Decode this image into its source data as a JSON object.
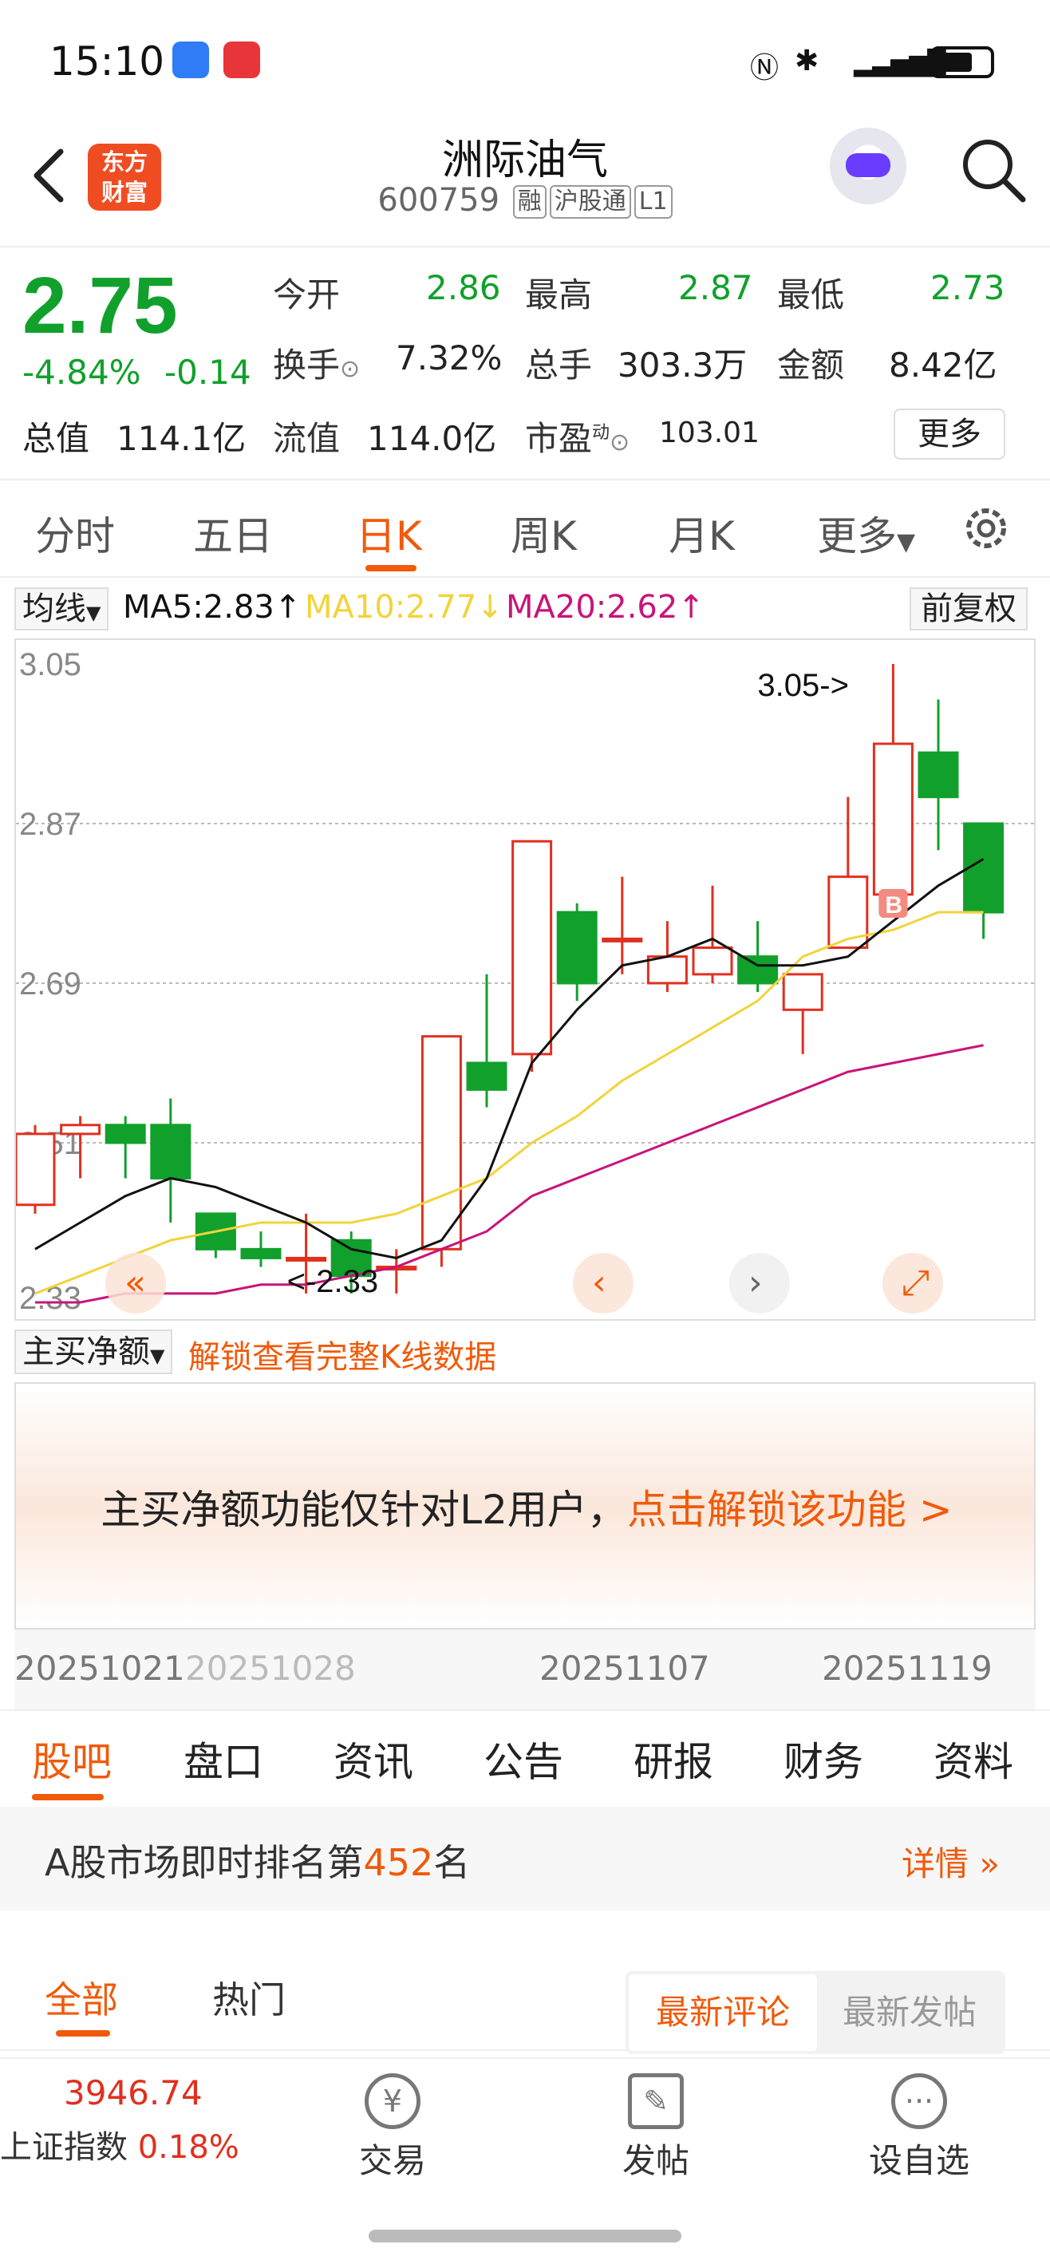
{
  "status_bar": {
    "time": "15:10"
  },
  "header": {
    "logo_line1": "东方",
    "logo_line2": "财富",
    "stock_name": "洲际油气",
    "stock_code": "600759",
    "tags": [
      "融",
      "沪股通",
      "L1"
    ]
  },
  "quote": {
    "price": "2.75",
    "change_pct": "-4.84%",
    "change_amt": "-0.14",
    "open_label": "今开",
    "open": "2.86",
    "high_label": "最高",
    "high": "2.87",
    "low_label": "最低",
    "low": "2.73",
    "turnover_label": "换手",
    "turnover": "7.32%",
    "volume_label": "总手",
    "volume": "303.3万",
    "amount_label": "金额",
    "amount": "8.42亿",
    "mktcap_label": "总值",
    "mktcap": "114.1亿",
    "float_label": "流值",
    "float": "114.0亿",
    "pe_label": "市盈",
    "pe_sup": "动",
    "pe": "103.01",
    "more_label": "更多"
  },
  "period_tabs": [
    "分时",
    "五日",
    "日K",
    "周K",
    "月K",
    "更多"
  ],
  "ma_row": {
    "selector": "均线",
    "ma5": "MA5:2.83",
    "ma10": "MA10:2.77",
    "ma20": "MA20:2.62",
    "adjust": "前复权"
  },
  "colors": {
    "up": "#e0301e",
    "down": "#11a02c",
    "accent": "#f05a0a",
    "ma5": "#111111",
    "ma10": "#f2d33a",
    "ma20": "#c8147a"
  },
  "chart_data": {
    "type": "candlestick",
    "ylim": [
      2.33,
      3.05
    ],
    "y_ticks": [
      "3.05",
      "2.87",
      "2.69",
      "2.51",
      "2.33"
    ],
    "max_annotation": "3.05->",
    "min_annotation": "<-2.33",
    "buy_marker": "B",
    "candles": [
      {
        "o": 2.44,
        "c": 2.52,
        "h": 2.53,
        "l": 2.43
      },
      {
        "o": 2.52,
        "c": 2.53,
        "h": 2.54,
        "l": 2.47
      },
      {
        "o": 2.53,
        "c": 2.51,
        "h": 2.54,
        "l": 2.47
      },
      {
        "o": 2.53,
        "c": 2.47,
        "h": 2.56,
        "l": 2.42
      },
      {
        "o": 2.43,
        "c": 2.39,
        "h": 2.43,
        "l": 2.38
      },
      {
        "o": 2.39,
        "c": 2.38,
        "h": 2.41,
        "l": 2.37
      },
      {
        "o": 2.38,
        "c": 2.38,
        "h": 2.43,
        "l": 2.34
      },
      {
        "o": 2.4,
        "c": 2.36,
        "h": 2.41,
        "l": 2.34
      },
      {
        "o": 2.37,
        "c": 2.37,
        "h": 2.39,
        "l": 2.34
      },
      {
        "o": 2.39,
        "c": 2.63,
        "h": 2.63,
        "l": 2.37
      },
      {
        "o": 2.6,
        "c": 2.57,
        "h": 2.7,
        "l": 2.55
      },
      {
        "o": 2.61,
        "c": 2.85,
        "h": 2.85,
        "l": 2.59
      },
      {
        "o": 2.77,
        "c": 2.69,
        "h": 2.78,
        "l": 2.67
      },
      {
        "o": 2.74,
        "c": 2.74,
        "h": 2.81,
        "l": 2.7
      },
      {
        "o": 2.69,
        "c": 2.72,
        "h": 2.76,
        "l": 2.68
      },
      {
        "o": 2.7,
        "c": 2.73,
        "h": 2.8,
        "l": 2.69
      },
      {
        "o": 2.72,
        "c": 2.69,
        "h": 2.76,
        "l": 2.68
      },
      {
        "o": 2.66,
        "c": 2.7,
        "h": 2.7,
        "l": 2.61
      },
      {
        "o": 2.73,
        "c": 2.81,
        "h": 2.9,
        "l": 2.73
      },
      {
        "o": 2.79,
        "c": 2.96,
        "h": 3.05,
        "l": 2.79
      },
      {
        "o": 2.95,
        "c": 2.9,
        "h": 3.01,
        "l": 2.84
      },
      {
        "o": 2.87,
        "c": 2.77,
        "h": 2.87,
        "l": 2.74
      }
    ],
    "ma5": [
      2.39,
      2.42,
      2.45,
      2.47,
      2.46,
      2.44,
      2.42,
      2.39,
      2.38,
      2.4,
      2.47,
      2.6,
      2.66,
      2.71,
      2.72,
      2.74,
      2.71,
      2.71,
      2.72,
      2.76,
      2.8,
      2.83
    ],
    "ma10": [
      2.34,
      2.36,
      2.38,
      2.4,
      2.41,
      2.42,
      2.42,
      2.42,
      2.43,
      2.45,
      2.47,
      2.51,
      2.54,
      2.58,
      2.61,
      2.64,
      2.67,
      2.72,
      2.74,
      2.75,
      2.77,
      2.77
    ],
    "ma20": [
      2.33,
      2.33,
      2.34,
      2.34,
      2.34,
      2.35,
      2.35,
      2.36,
      2.37,
      2.39,
      2.41,
      2.45,
      2.47,
      2.49,
      2.51,
      2.53,
      2.55,
      2.57,
      2.59,
      2.6,
      2.61,
      2.62
    ]
  },
  "net_flow": {
    "selector": "主买净额",
    "unlock_link": "解锁查看完整K线数据",
    "notice": "主买净额功能仅针对L2用户，",
    "notice_link": "点击解锁该功能 >"
  },
  "x_dates": [
    "20251021",
    "20251028",
    "20251107",
    "20251119"
  ],
  "bottom_tabs": [
    "股吧",
    "盘口",
    "资讯",
    "公告",
    "研报",
    "财务",
    "资料"
  ],
  "rank": {
    "prefix": "A股市场即时排名第",
    "number": "452",
    "suffix": "名",
    "details": "详情"
  },
  "filter": {
    "tabs": [
      "全部",
      "热门"
    ],
    "sort_a": "最新评论",
    "sort_b": "最新发帖"
  },
  "bottom_bar": {
    "index_value": "3946.74",
    "index_name": "上证指数",
    "index_change": "0.18%",
    "trade": "交易",
    "post": "发帖",
    "watchlist": "设自选"
  }
}
